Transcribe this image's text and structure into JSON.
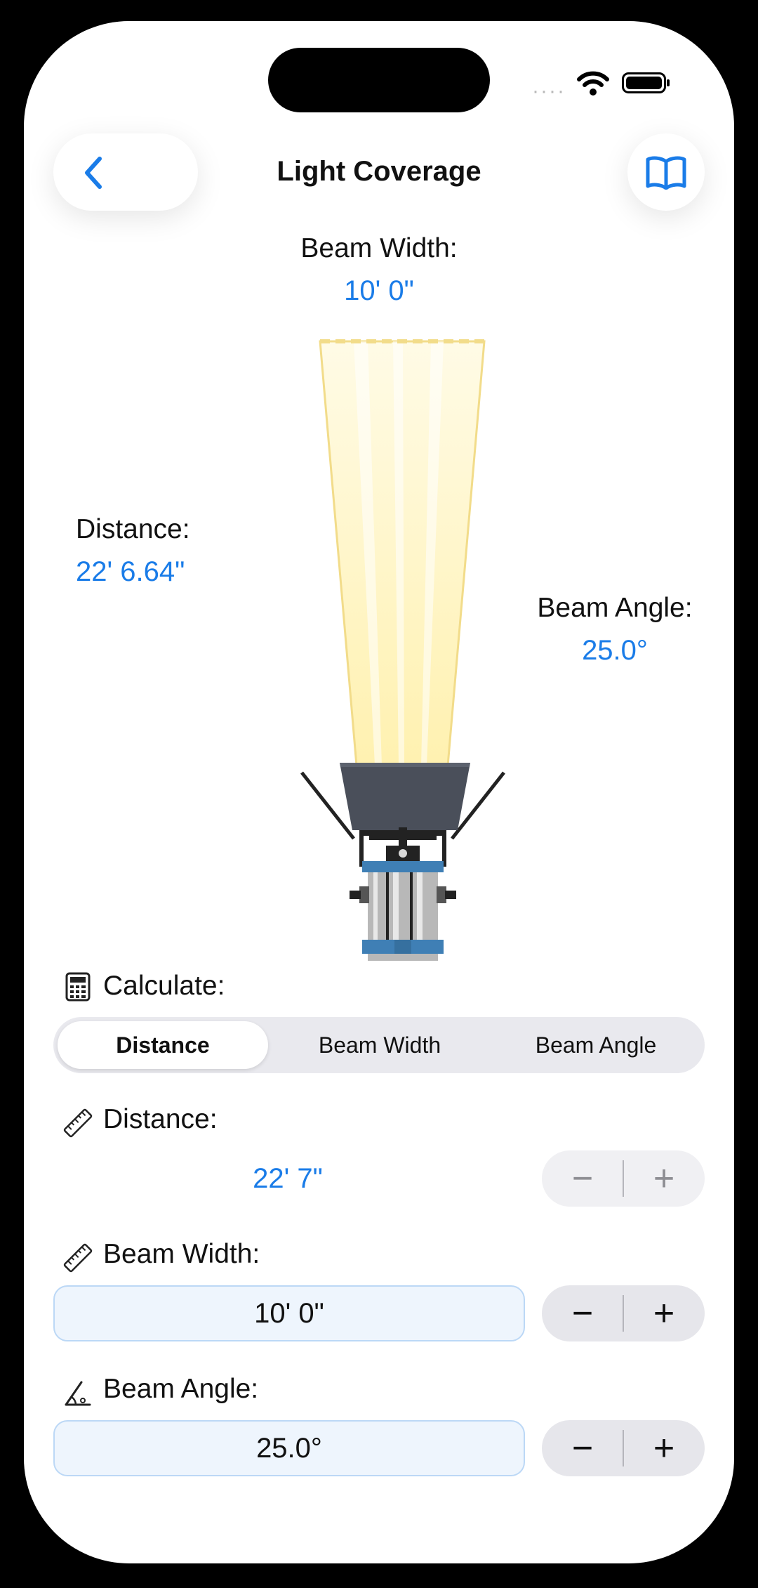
{
  "nav": {
    "title": "Light Coverage",
    "back_icon": "chevron-left-icon",
    "help_icon": "book-icon"
  },
  "diagram": {
    "beam_width_label": "Beam Width:",
    "beam_width_value": "10' 0\"",
    "distance_label": "Distance:",
    "distance_value": "22' 6.64\"",
    "beam_angle_label": "Beam Angle:",
    "beam_angle_value": "25.0°"
  },
  "calculate": {
    "label": "Calculate:",
    "icon": "calculator-icon",
    "options": [
      "Distance",
      "Beam Width",
      "Beam Angle"
    ],
    "selected": "Distance"
  },
  "inputs": {
    "distance": {
      "label": "Distance:",
      "icon": "ruler-icon",
      "value": "22' 7\"",
      "minus": "−",
      "plus": "+"
    },
    "beam_width": {
      "label": "Beam Width:",
      "icon": "ruler-icon",
      "value": "10' 0\"",
      "minus": "−",
      "plus": "+"
    },
    "beam_angle": {
      "label": "Beam Angle:",
      "icon": "angle-icon",
      "value": "25.0°",
      "minus": "−",
      "plus": "+"
    }
  },
  "colors": {
    "accent": "#1a7ce8",
    "fixture_body": "#4a4f5a",
    "fixture_band": "#3f7fb5",
    "beam": "#fff3b8"
  }
}
